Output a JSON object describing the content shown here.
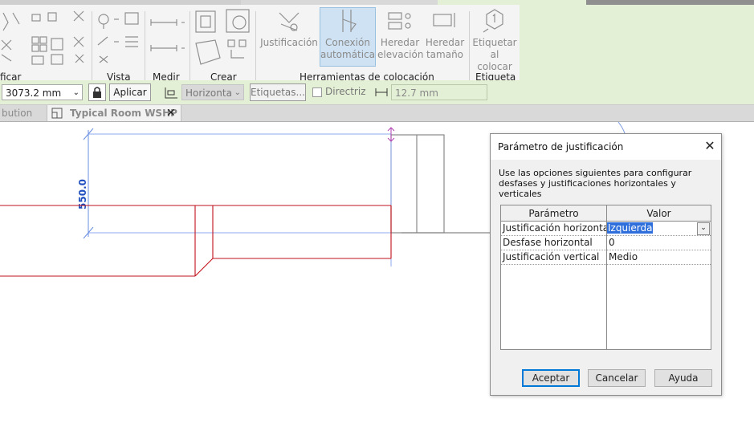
{
  "ribbon": {
    "panels": {
      "modify_label": "ficar",
      "view_label": "Vista",
      "measure_label": "Medir",
      "create_label": "Crear",
      "placement_tools_label": "Herramientas de colocación",
      "tag_label": "Etiqueta"
    },
    "buttons": {
      "justification": "Justificación",
      "auto_connect_1": "Conexión",
      "auto_connect_2": "automática",
      "inherit_elev_1": "Heredar",
      "inherit_elev_2": "elevación",
      "inherit_size_1": "Heredar",
      "inherit_size_2": "tamaño",
      "tag_on_place_1": "Etiquetar",
      "tag_on_place_2": "al colocar"
    }
  },
  "options_bar": {
    "offset_value": "3073.2 mm",
    "apply_button": "Aplicar",
    "orientation_value": "Horizonta",
    "tags_button": "Etiquetas...",
    "leader_label": "Directriz",
    "leader_length": "12.7 mm"
  },
  "tabs": {
    "prev_tab": "bution",
    "active_tab": "Typical Room WSHP"
  },
  "canvas": {
    "dimension_label": "550.0"
  },
  "dialog": {
    "title": "Parámetro de justificación",
    "description": "Use las opciones siguientes para configurar desfases y justificaciones horizontales y verticales",
    "columns": [
      "Parámetro",
      "Valor"
    ],
    "rows": [
      {
        "param": "Justificación horizontal",
        "value": "Izquierda"
      },
      {
        "param": "Desfase horizontal",
        "value": "0"
      },
      {
        "param": "Justificación vertical",
        "value": "Medio"
      }
    ],
    "ok_button": "Aceptar",
    "cancel_button": "Cancelar",
    "help_button": "Ayuda"
  },
  "colors": {
    "ribbon_accent": "#e4f0d6",
    "selection_blue": "#2f6fdb",
    "duct_red": "#c0101b",
    "dimension_blue": "#6a8fe0"
  }
}
